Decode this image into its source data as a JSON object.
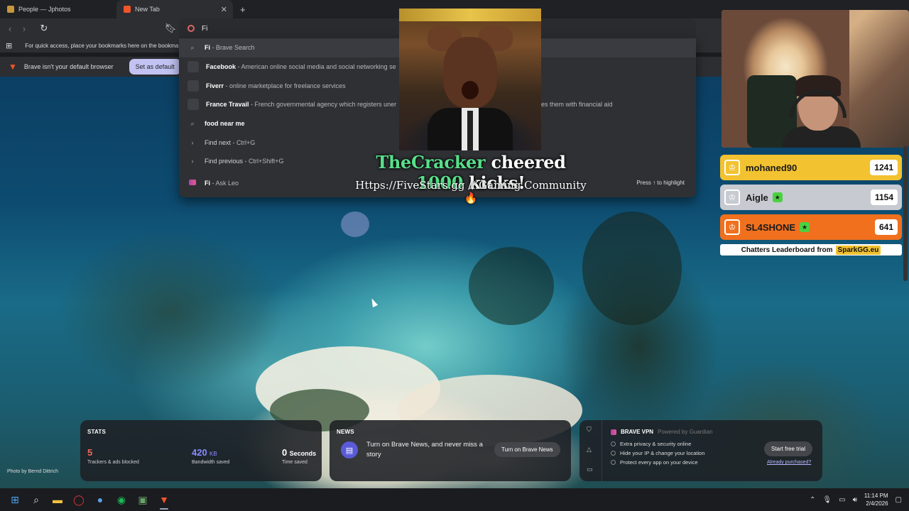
{
  "tabs": [
    {
      "label": "People — Jphotos",
      "active": false
    },
    {
      "label": "New Tab",
      "active": true
    }
  ],
  "omnibox": {
    "value": "Fi"
  },
  "bookmarks_bar": {
    "hint": "For quick access, place your bookmarks here on the bookma"
  },
  "default_banner": {
    "message": "Brave isn't your default browser",
    "button": "Set as default"
  },
  "suggestions": [
    {
      "icon": "search-icon",
      "title": "Fi",
      "desc": " - Brave Search"
    },
    {
      "icon": "site-icon",
      "title": "Facebook",
      "desc": " - American online social media and social networking se"
    },
    {
      "icon": "site-icon",
      "title": "Fiverr",
      "desc": " - online marketplace for freelance services"
    },
    {
      "icon": "site-icon",
      "title": "France Travail",
      "desc": " - French governmental agency which registers uner",
      "desc_tail": "es them with financial aid"
    },
    {
      "icon": "search-icon",
      "title": "food near me",
      "desc": ""
    },
    {
      "icon": "chevron-right-icon",
      "title": "Find next",
      "desc": " - Ctrl+G"
    },
    {
      "icon": "chevron-right-icon",
      "title": "Find previous",
      "desc": " - Ctrl+Shift+G"
    },
    {
      "icon": "leo-icon",
      "title": "Fi",
      "desc": " - Ask Leo"
    }
  ],
  "press_hint": "Press ↑ to highlight",
  "overlay": {
    "alert_user": "TheCracker",
    "alert_mid": " cheered ",
    "alert_amount": "1000",
    "alert_end": " kicks!",
    "alert_sub": "Https://FiveStars.gg // Gaming Community 🔥"
  },
  "leaderboard": {
    "rows": [
      {
        "name": "mohaned90",
        "score": "1241"
      },
      {
        "name": "Aigle",
        "score": "1154"
      },
      {
        "name": "SL4SHONE",
        "score": "641"
      }
    ],
    "footer_text": "Chatters Leaderboard from",
    "footer_brand": "SparkGG.eu"
  },
  "stats": {
    "title": "STATS",
    "trackers_value": "5",
    "trackers_label": "Trackers & ads blocked",
    "bandwidth_value": "420",
    "bandwidth_unit": "KB",
    "bandwidth_label": "Bandwidth saved",
    "time_value": "0",
    "time_unit": "Seconds",
    "time_label": "Time saved"
  },
  "news": {
    "title": "NEWS",
    "text": "Turn on Brave News, and never miss a story",
    "button": "Turn on Brave News"
  },
  "vpn": {
    "title": "BRAVE VPN",
    "powered": "Powered by Guardian",
    "features": [
      "Extra privacy & security online",
      "Hide your IP & change your location",
      "Protect every app on your device"
    ],
    "button": "Start free trial",
    "link": "Already purchased?"
  },
  "photo_credit": "Photo by Bernd Dittrich",
  "clock": {
    "time": "11:14 PM",
    "date": "2/4/2026"
  },
  "colors": {
    "accent_button": "#c2c3f3",
    "trackers": "#f26b5b",
    "bandwidth": "#8b8bff",
    "alert_green": "#57e08a",
    "gold": "#f2c230",
    "silver": "#c7cad0",
    "bronze": "#f0701e"
  }
}
